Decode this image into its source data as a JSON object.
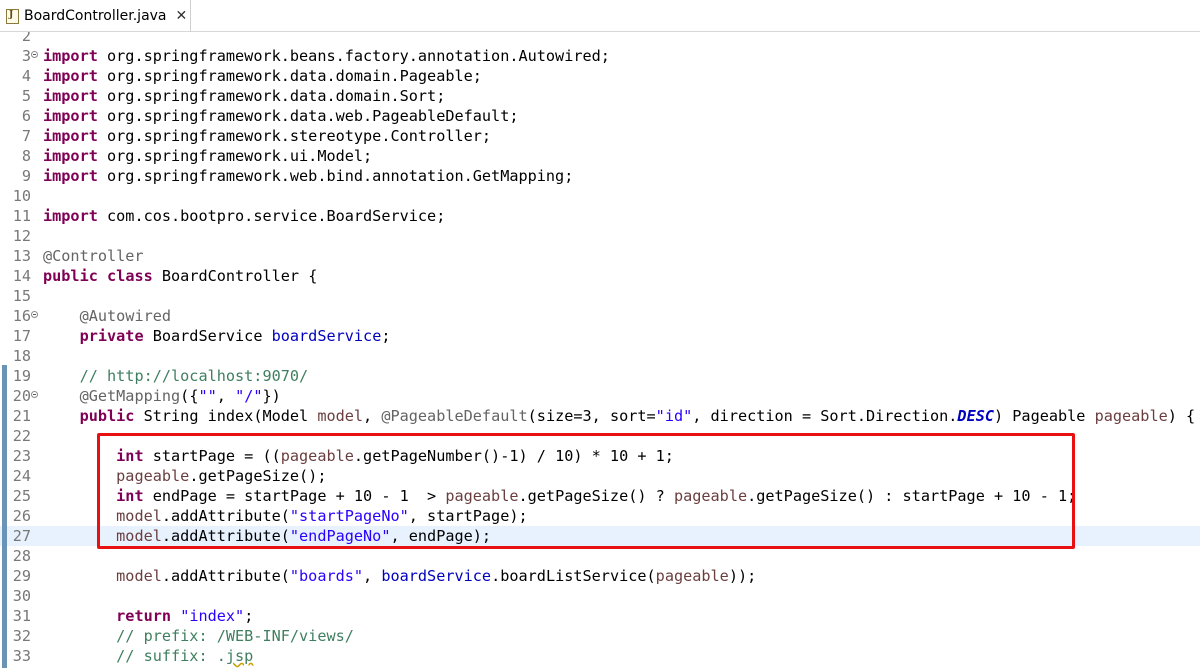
{
  "tab": {
    "icon": "java-file-icon",
    "icon_glyph": "J",
    "title": "BoardController.java",
    "close": "✕"
  },
  "editor": {
    "lines": [
      {
        "no": "2",
        "tokens": []
      },
      {
        "no": "3",
        "fold": true,
        "tokens": [
          [
            "kw",
            "import"
          ],
          [
            "t",
            " org.springframework.beans.factory.annotation.Autowired;"
          ]
        ]
      },
      {
        "no": "4",
        "tokens": [
          [
            "kw",
            "import"
          ],
          [
            "t",
            " org.springframework.data.domain.Pageable;"
          ]
        ]
      },
      {
        "no": "5",
        "tokens": [
          [
            "kw",
            "import"
          ],
          [
            "t",
            " org.springframework.data.domain.Sort;"
          ]
        ]
      },
      {
        "no": "6",
        "tokens": [
          [
            "kw",
            "import"
          ],
          [
            "t",
            " org.springframework.data.web.PageableDefault;"
          ]
        ]
      },
      {
        "no": "7",
        "tokens": [
          [
            "kw",
            "import"
          ],
          [
            "t",
            " org.springframework.stereotype.Controller;"
          ]
        ]
      },
      {
        "no": "8",
        "tokens": [
          [
            "kw",
            "import"
          ],
          [
            "t",
            " org.springframework.ui.Model;"
          ]
        ]
      },
      {
        "no": "9",
        "tokens": [
          [
            "kw",
            "import"
          ],
          [
            "t",
            " org.springframework.web.bind.annotation.GetMapping;"
          ]
        ]
      },
      {
        "no": "10",
        "tokens": []
      },
      {
        "no": "11",
        "tokens": [
          [
            "kw",
            "import"
          ],
          [
            "t",
            " com.cos.bootpro.service.BoardService;"
          ]
        ]
      },
      {
        "no": "12",
        "tokens": []
      },
      {
        "no": "13",
        "tokens": [
          [
            "ann",
            "@Controller"
          ]
        ]
      },
      {
        "no": "14",
        "tokens": [
          [
            "kw",
            "public"
          ],
          [
            "t",
            " "
          ],
          [
            "kw",
            "class"
          ],
          [
            "t",
            " BoardController {"
          ]
        ]
      },
      {
        "no": "15",
        "tokens": []
      },
      {
        "no": "16",
        "fold": true,
        "tokens": [
          [
            "t",
            "    "
          ],
          [
            "ann",
            "@Autowired"
          ]
        ]
      },
      {
        "no": "17",
        "tokens": [
          [
            "t",
            "    "
          ],
          [
            "kw",
            "private"
          ],
          [
            "t",
            " BoardService "
          ],
          [
            "fld",
            "boardService"
          ],
          [
            "t",
            ";"
          ]
        ]
      },
      {
        "no": "18",
        "tokens": []
      },
      {
        "no": "19",
        "tokens": [
          [
            "t",
            "    "
          ],
          [
            "cm",
            "// http://localhost:9070/"
          ]
        ]
      },
      {
        "no": "20",
        "fold": true,
        "tokens": [
          [
            "t",
            "    "
          ],
          [
            "ann",
            "@GetMapping"
          ],
          [
            "t",
            "({"
          ],
          [
            "str",
            "\"\""
          ],
          [
            "t",
            ", "
          ],
          [
            "str",
            "\"/\""
          ],
          [
            "t",
            "})"
          ]
        ]
      },
      {
        "no": "21",
        "tokens": [
          [
            "t",
            "    "
          ],
          [
            "kw",
            "public"
          ],
          [
            "t",
            " String index(Model "
          ],
          [
            "prm",
            "model"
          ],
          [
            "t",
            ", "
          ],
          [
            "ann",
            "@PageableDefault"
          ],
          [
            "t",
            "(size=3, sort="
          ],
          [
            "str",
            "\"id\""
          ],
          [
            "t",
            ", direction = Sort.Direction."
          ],
          [
            "cst",
            "DESC"
          ],
          [
            "t",
            ") Pageable "
          ],
          [
            "prm",
            "pageable"
          ],
          [
            "t",
            ") {"
          ]
        ]
      },
      {
        "no": "22",
        "tokens": []
      },
      {
        "no": "23",
        "tokens": [
          [
            "t",
            "        "
          ],
          [
            "kw",
            "int"
          ],
          [
            "t",
            " startPage = (("
          ],
          [
            "prm",
            "pageable"
          ],
          [
            "t",
            ".getPageNumber()-1) / 10) * 10 + 1;"
          ]
        ]
      },
      {
        "no": "24",
        "tokens": [
          [
            "t",
            "        "
          ],
          [
            "prm",
            "pageable"
          ],
          [
            "t",
            ".getPageSize();"
          ]
        ]
      },
      {
        "no": "25",
        "tokens": [
          [
            "t",
            "        "
          ],
          [
            "kw",
            "int"
          ],
          [
            "t",
            " endPage = startPage + 10 - 1  > "
          ],
          [
            "prm",
            "pageable"
          ],
          [
            "t",
            ".getPageSize() ? "
          ],
          [
            "prm",
            "pageable"
          ],
          [
            "t",
            ".getPageSize() : startPage + 10 - 1;"
          ]
        ]
      },
      {
        "no": "26",
        "tokens": [
          [
            "t",
            "        "
          ],
          [
            "prm",
            "model"
          ],
          [
            "t",
            ".addAttribute("
          ],
          [
            "str",
            "\"startPageNo\""
          ],
          [
            "t",
            ", startPage);"
          ]
        ]
      },
      {
        "no": "27",
        "current": true,
        "tokens": [
          [
            "t",
            "        "
          ],
          [
            "prm",
            "model"
          ],
          [
            "t",
            ".addAttribute("
          ],
          [
            "str",
            "\"endPageNo\""
          ],
          [
            "t",
            ", endPage);"
          ]
        ]
      },
      {
        "no": "28",
        "tokens": []
      },
      {
        "no": "29",
        "tokens": [
          [
            "t",
            "        "
          ],
          [
            "prm",
            "model"
          ],
          [
            "t",
            ".addAttribute("
          ],
          [
            "str",
            "\"boards\""
          ],
          [
            "t",
            ", "
          ],
          [
            "fld",
            "boardService"
          ],
          [
            "t",
            ".boardListService("
          ],
          [
            "prm",
            "pageable"
          ],
          [
            "t",
            "));"
          ]
        ]
      },
      {
        "no": "30",
        "tokens": []
      },
      {
        "no": "31",
        "tokens": [
          [
            "t",
            "        "
          ],
          [
            "kw",
            "return"
          ],
          [
            "t",
            " "
          ],
          [
            "str",
            "\"index\""
          ],
          [
            "t",
            ";"
          ]
        ]
      },
      {
        "no": "32",
        "tokens": [
          [
            "t",
            "        "
          ],
          [
            "cm",
            "// prefix: /WEB-INF/views/"
          ]
        ]
      },
      {
        "no": "33",
        "tokens": [
          [
            "t",
            "        "
          ],
          [
            "cm",
            "// suffix: ."
          ],
          [
            "cmsq",
            "jsp"
          ]
        ]
      }
    ]
  },
  "colors": {
    "keyword": "#7f0055",
    "annotation": "#646464",
    "comment": "#3f7f5f",
    "string": "#2a00ff",
    "field": "#0000c0",
    "parameter": "#6a3e3e",
    "current_line": "#e8f2fe",
    "highlight_box": "#e81010"
  }
}
